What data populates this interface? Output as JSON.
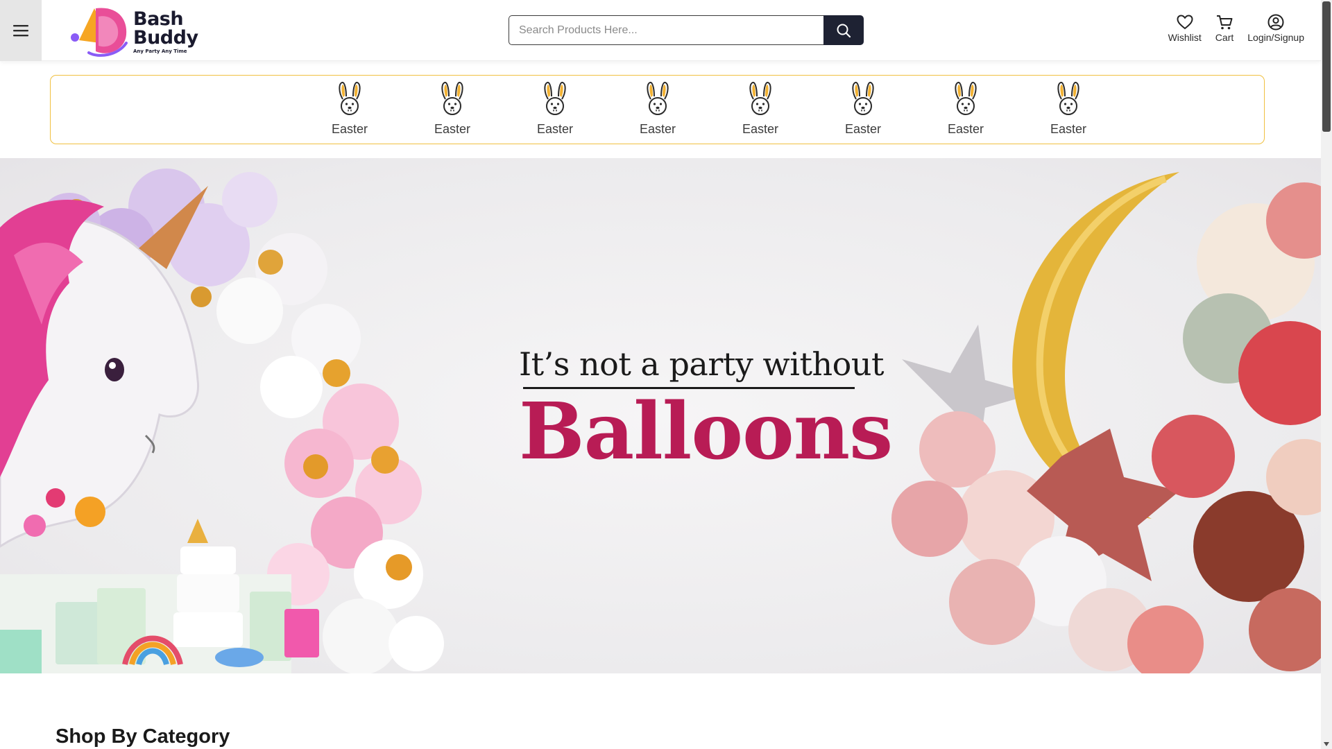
{
  "header": {
    "logo": {
      "line1": "Bash",
      "line2": "Buddy",
      "tagline": "Any Party Any Time"
    },
    "search": {
      "placeholder": "Search Products Here...",
      "value": ""
    },
    "actions": [
      {
        "icon": "heart-icon",
        "label": "Wishlist"
      },
      {
        "icon": "cart-icon",
        "label": "Cart"
      },
      {
        "icon": "user-circle-icon",
        "label": "Login/Signup"
      }
    ]
  },
  "categories": [
    {
      "icon": "bunny-icon",
      "label": "Easter"
    },
    {
      "icon": "bunny-icon",
      "label": "Easter"
    },
    {
      "icon": "bunny-icon",
      "label": "Easter"
    },
    {
      "icon": "bunny-icon",
      "label": "Easter"
    },
    {
      "icon": "bunny-icon",
      "label": "Easter"
    },
    {
      "icon": "bunny-icon",
      "label": "Easter"
    },
    {
      "icon": "bunny-icon",
      "label": "Easter"
    },
    {
      "icon": "bunny-icon",
      "label": "Easter"
    }
  ],
  "hero": {
    "line1": "It’s not a party without",
    "line2": "Balloons"
  },
  "sections": {
    "shop_by_category": "Shop By Category"
  },
  "colors": {
    "accent_dark": "#1e2233",
    "category_border": "#f0c040",
    "hero_highlight": "#b81c55"
  }
}
